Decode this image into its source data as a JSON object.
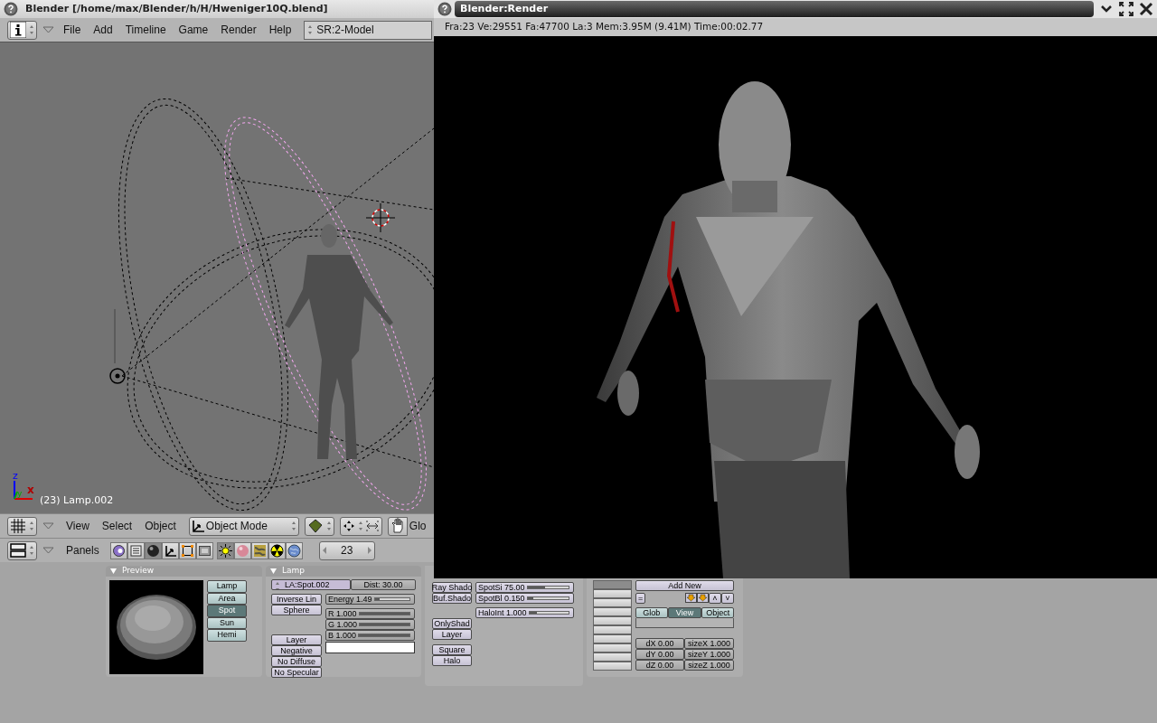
{
  "main_window": {
    "title": "Blender [/home/max/Blender/h/H/Hweniger10Q.blend]"
  },
  "menu_bar": {
    "menus": [
      "File",
      "Add",
      "Timeline",
      "Game",
      "Render",
      "Help"
    ],
    "scene": "SR:2-Model"
  },
  "viewport": {
    "axes": [
      "z",
      "y",
      "x"
    ],
    "object_label": "(23) Lamp.002"
  },
  "view_header": {
    "menus": [
      "View",
      "Select",
      "Object"
    ],
    "mode": "Object Mode",
    "cut_label": "Glo"
  },
  "buttons_header": {
    "label": "Panels",
    "context_tabs": [
      {
        "kind": "logic",
        "selected": false
      },
      {
        "kind": "script",
        "selected": false
      },
      {
        "kind": "shading",
        "selected": true
      },
      {
        "kind": "object",
        "selected": false
      },
      {
        "kind": "editing",
        "selected": false
      },
      {
        "kind": "scene",
        "selected": false
      }
    ],
    "shading_tabs": [
      {
        "kind": "lamp",
        "selected": true
      },
      {
        "kind": "material",
        "selected": false
      },
      {
        "kind": "texture",
        "selected": false
      },
      {
        "kind": "radiosity",
        "selected": false
      },
      {
        "kind": "world",
        "selected": false
      }
    ],
    "frame": "23"
  },
  "preview_panel": {
    "title": "Preview",
    "types": [
      {
        "label": "Lamp",
        "selected": false
      },
      {
        "label": "Area",
        "selected": false
      },
      {
        "label": "Spot",
        "selected": true
      },
      {
        "label": "Sun",
        "selected": false
      },
      {
        "label": "Hemi",
        "selected": false
      }
    ]
  },
  "lamp_panel": {
    "title": "Lamp",
    "datablock": "LA:Spot.002",
    "dist": "Dist: 30.00",
    "falloff": "Inverse Lin",
    "sphere": "Sphere",
    "energy": {
      "label": "Energy 1.49",
      "level": 0.15
    },
    "colors": [
      {
        "label": "R 1.000",
        "level": 1
      },
      {
        "label": "G 1.000",
        "level": 1
      },
      {
        "label": "B 1.000",
        "level": 1
      }
    ],
    "toggles": [
      "Layer",
      "Negative",
      "No Diffuse",
      "No Specular"
    ]
  },
  "shadow_panel": {
    "buttons": [
      [
        "Ray Shado",
        "Buf.Shado"
      ],
      [
        "OnlyShad",
        "Layer"
      ],
      [
        "Square",
        "Halo"
      ]
    ],
    "sliders": [
      {
        "label": "SpotSi 75.00",
        "level": 0.42
      },
      {
        "label": "SpotBl 0.150",
        "level": 0.15
      },
      {
        "label": "HaloInt 1.000",
        "level": 0.2
      }
    ]
  },
  "texture_panel": {
    "channels": [
      {
        "selected": true
      },
      {
        "selected": false
      },
      {
        "selected": false
      },
      {
        "selected": false
      },
      {
        "selected": false
      },
      {
        "selected": false
      },
      {
        "selected": false
      },
      {
        "selected": false
      },
      {
        "selected": false
      },
      {
        "selected": false
      }
    ],
    "add_new": "Add New",
    "link": "=",
    "arrows": [
      "˄",
      "˅"
    ],
    "coords": [
      {
        "label": "Glob",
        "selected": false
      },
      {
        "label": "View",
        "selected": true
      },
      {
        "label": "Object",
        "selected": false
      }
    ],
    "offsets": [
      "dX 0.00",
      "dY 0.00",
      "dZ 0.00"
    ],
    "sizes": [
      "sizeX 1.000",
      "sizeY 1.000",
      "sizeZ 1.000"
    ]
  },
  "render_window": {
    "title": "Blender:Render",
    "stats": "Fra:23  Ve:29551 Fa:47700 La:3 Mem:3.95M (9.41M) Time:00:02.77"
  }
}
